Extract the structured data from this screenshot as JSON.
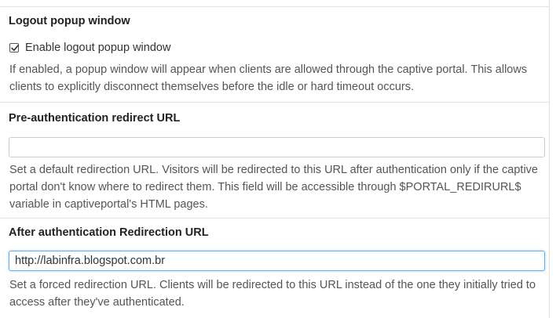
{
  "logout_popup": {
    "heading": "Logout popup window",
    "checkbox_label": "Enable logout popup window",
    "checked": true,
    "help": "If enabled, a popup window will appear when clients are allowed through the captive portal. This allows clients to explicitly disconnect themselves before the idle or hard timeout occurs."
  },
  "preauth_redirect": {
    "heading": "Pre-authentication redirect URL",
    "value": "",
    "help": "Set a default redirection URL. Visitors will be redirected to this URL after authentication only if the captive portal don't know where to redirect them. This field will be accessible through $PORTAL_REDIRURL$ variable in captiveportal's HTML pages."
  },
  "after_auth_redirect": {
    "heading": "After authentication Redirection URL",
    "value": "http://labinfra.blogspot.com.br",
    "help": "Set a forced redirection URL. Clients will be redirected to this URL instead of the one they initially tried to access after they've authenticated."
  }
}
